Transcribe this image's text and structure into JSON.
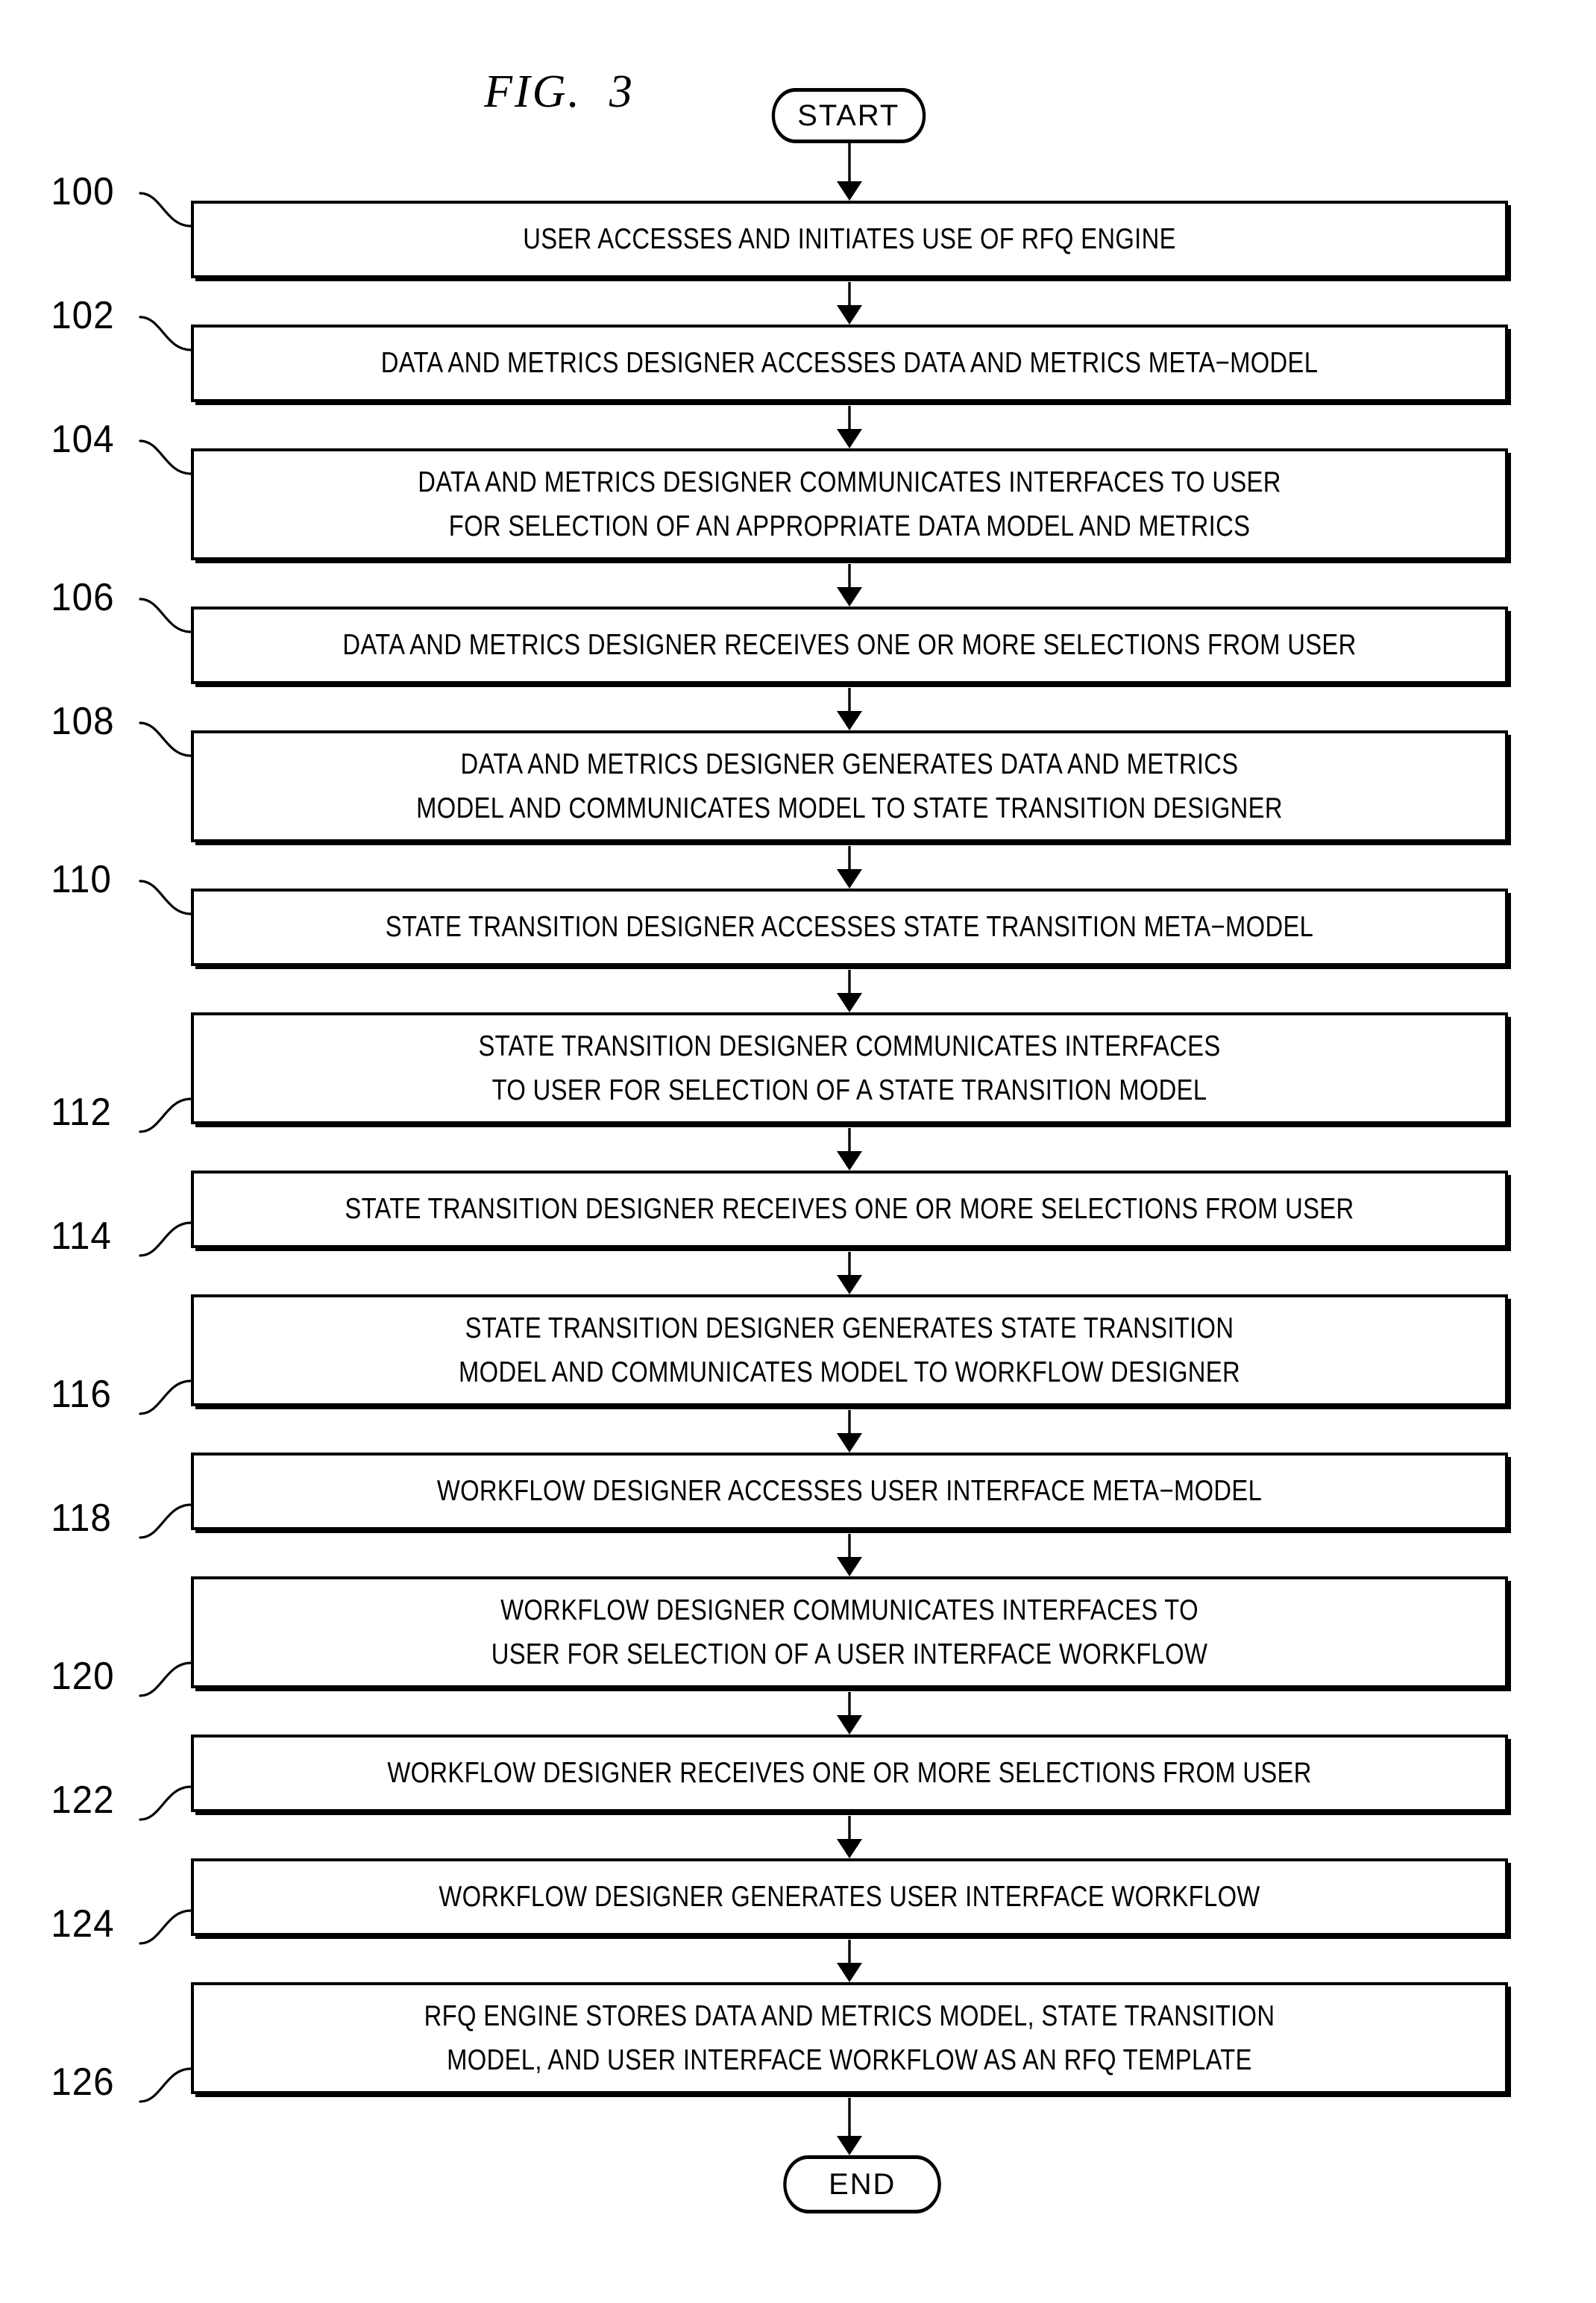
{
  "figure": {
    "title": "FIG.  3"
  },
  "terminators": {
    "start": "START",
    "end": "END"
  },
  "steps": [
    {
      "ref": "100",
      "text": "USER ACCESSES AND INITIATES USE OF RFQ ENGINE",
      "lines": 1
    },
    {
      "ref": "102",
      "text": "DATA AND METRICS DESIGNER ACCESSES DATA AND METRICS META−MODEL",
      "lines": 1
    },
    {
      "ref": "104",
      "text": "DATA AND METRICS DESIGNER COMMUNICATES INTERFACES TO USER\nFOR SELECTION OF AN APPROPRIATE DATA MODEL AND METRICS",
      "lines": 2
    },
    {
      "ref": "106",
      "text": "DATA AND METRICS DESIGNER RECEIVES ONE OR MORE SELECTIONS FROM USER",
      "lines": 1
    },
    {
      "ref": "108",
      "text": "DATA AND METRICS DESIGNER GENERATES DATA AND METRICS\nMODEL AND COMMUNICATES MODEL TO STATE TRANSITION DESIGNER",
      "lines": 2
    },
    {
      "ref": "110",
      "text": "STATE TRANSITION DESIGNER ACCESSES STATE TRANSITION META−MODEL",
      "lines": 1
    },
    {
      "ref": "112",
      "text": "STATE TRANSITION DESIGNER COMMUNICATES INTERFACES\nTO USER FOR SELECTION OF A STATE TRANSITION MODEL",
      "lines": 2
    },
    {
      "ref": "114",
      "text": "STATE TRANSITION DESIGNER RECEIVES ONE OR MORE SELECTIONS FROM USER",
      "lines": 1
    },
    {
      "ref": "116",
      "text": "STATE TRANSITION DESIGNER GENERATES STATE TRANSITION\nMODEL AND COMMUNICATES MODEL TO WORKFLOW DESIGNER",
      "lines": 2
    },
    {
      "ref": "118",
      "text": "WORKFLOW DESIGNER ACCESSES USER INTERFACE META−MODEL",
      "lines": 1
    },
    {
      "ref": "120",
      "text": "WORKFLOW DESIGNER COMMUNICATES INTERFACES TO\nUSER FOR SELECTION OF A USER INTERFACE WORKFLOW",
      "lines": 2
    },
    {
      "ref": "122",
      "text": "WORKFLOW DESIGNER RECEIVES ONE OR MORE SELECTIONS FROM USER",
      "lines": 1
    },
    {
      "ref": "124",
      "text": "WORKFLOW DESIGNER GENERATES USER INTERFACE WORKFLOW",
      "lines": 1
    },
    {
      "ref": "126",
      "text": "RFQ ENGINE STORES DATA AND METRICS MODEL, STATE TRANSITION\nMODEL, AND USER INTERFACE WORKFLOW AS AN RFQ TEMPLATE",
      "lines": 2
    }
  ],
  "colors": {
    "ink": "#000000",
    "paper": "#ffffff"
  }
}
